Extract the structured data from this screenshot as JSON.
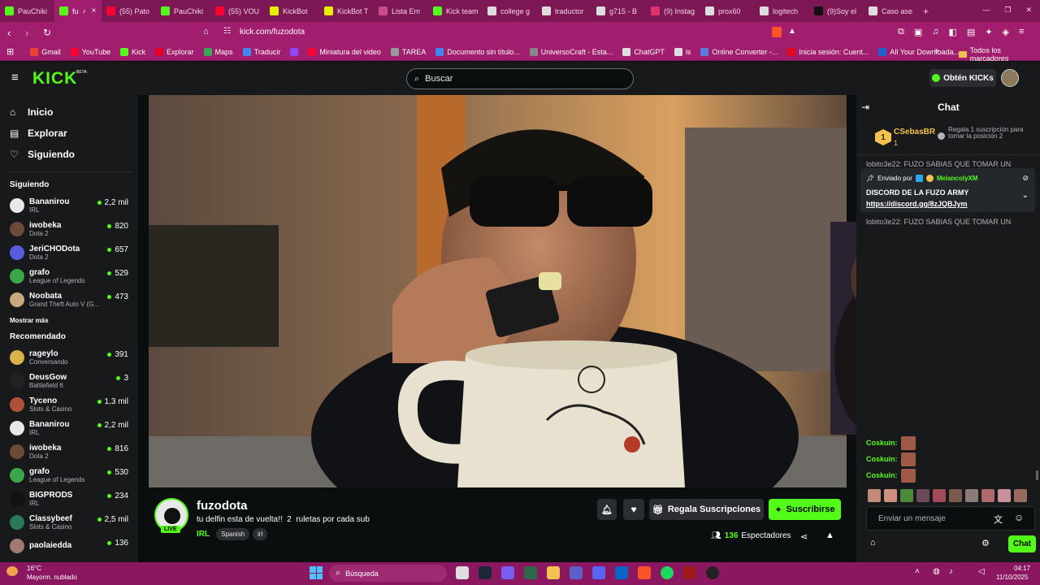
{
  "browser": {
    "tabs": [
      {
        "title": "PauChiki",
        "icon": "kick-icon",
        "color": "#53fc18"
      },
      {
        "title": "fu",
        "icon": "kick-icon",
        "color": "#53fc18",
        "active": true
      },
      {
        "title": "(55) Pato",
        "icon": "youtube-icon",
        "color": "#ff0033"
      },
      {
        "title": "PauChiki",
        "icon": "kick-icon",
        "color": "#53fc18"
      },
      {
        "title": "(55) VOU",
        "icon": "youtube-icon",
        "color": "#ff0033"
      },
      {
        "title": "KickBot",
        "icon": "kickbot-icon",
        "color": "#e4f000"
      },
      {
        "title": "KickBot T",
        "icon": "kickbot-icon",
        "color": "#e4f000"
      },
      {
        "title": "Lista Em",
        "icon": "list-icon",
        "color": "#c84b8b"
      },
      {
        "title": "Kick team",
        "icon": "kick-icon",
        "color": "#53fc18"
      },
      {
        "title": "college g",
        "icon": "globe-icon",
        "color": "#dddddd"
      },
      {
        "title": "traductor",
        "icon": "globe-icon",
        "color": "#dddddd"
      },
      {
        "title": "g715 - B",
        "icon": "globe-icon",
        "color": "#dddddd"
      },
      {
        "title": "(9) Instag",
        "icon": "instagram-icon",
        "color": "#e1306c"
      },
      {
        "title": "prox60",
        "icon": "globe-icon",
        "color": "#dddddd"
      },
      {
        "title": "logitech",
        "icon": "globe-icon",
        "color": "#dddddd"
      },
      {
        "title": "(9)Soy el",
        "icon": "tiktok-icon",
        "color": "#111111"
      },
      {
        "title": "Caso ase",
        "icon": "globe-icon",
        "color": "#dddddd"
      }
    ],
    "url": "kick.com/fuzodota",
    "bookmarks": [
      {
        "label": "Gmail",
        "color": "#ea4335"
      },
      {
        "label": "YouTube",
        "color": "#ff0033"
      },
      {
        "label": "Kick",
        "color": "#53fc18"
      },
      {
        "label": "Explorar",
        "color": "#e60023"
      },
      {
        "label": "Maps",
        "color": "#34a853"
      },
      {
        "label": "Traducir",
        "color": "#4285f4"
      },
      {
        "label": "",
        "color": "#9146ff"
      },
      {
        "label": "Miniatura del video",
        "color": "#ff0033"
      },
      {
        "label": "TAREA",
        "color": "#999999"
      },
      {
        "label": "Documento sin título...",
        "color": "#4285f4"
      },
      {
        "label": "UniversoCraft - Esta...",
        "color": "#888888"
      },
      {
        "label": "ChatGPT",
        "color": "#dddddd"
      },
      {
        "label": "is",
        "color": "#dddddd"
      },
      {
        "label": "Online Converter -...",
        "color": "#5a7be0"
      },
      {
        "label": "Inicia sesión: Cuent...",
        "color": "#e50914"
      },
      {
        "label": "All Your Downloada...",
        "color": "#1e63d6"
      }
    ],
    "bookmarks_all": "Todos los marcadores"
  },
  "kick": {
    "logo": "KICK",
    "beta": "BETA",
    "search_placeholder": "Buscar",
    "get_kicks": "Obtén KICKs",
    "nav": [
      {
        "label": "Inicio",
        "icon": "home-icon"
      },
      {
        "label": "Explorar",
        "icon": "explore-icon"
      },
      {
        "label": "Siguiendo",
        "icon": "heart-icon"
      }
    ],
    "following_title": "Siguiendo",
    "following": [
      {
        "name": "Bananirou",
        "category": "IRL",
        "viewers": "2,2 mil",
        "color": "#e8e8e8"
      },
      {
        "name": "iwobeka",
        "category": "Dota 2",
        "viewers": "820",
        "color": "#6b4a3a"
      },
      {
        "name": "JeriCHODota",
        "category": "Dota 2",
        "viewers": "657",
        "color": "#5a5ce0"
      },
      {
        "name": "grafo",
        "category": "League of Legends",
        "viewers": "529",
        "color": "#3aa84a"
      },
      {
        "name": "Noobata",
        "category": "Grand Theft Auto V (G...",
        "viewers": "473",
        "color": "#c9a880"
      }
    ],
    "show_more": "Mostrar más",
    "recommended_title": "Recomendado",
    "recommended": [
      {
        "name": "rageylo",
        "category": "Conversando",
        "viewers": "391",
        "color": "#d9b24a"
      },
      {
        "name": "DeusGow",
        "category": "Battlefield 6",
        "viewers": "3",
        "color": "#222222"
      },
      {
        "name": "Tyceno",
        "category": "Slots & Casino",
        "viewers": "1,3 mil",
        "color": "#b0503a"
      },
      {
        "name": "Bananirou",
        "category": "IRL",
        "viewers": "2,2 mil",
        "color": "#e8e8e8"
      },
      {
        "name": "iwobeka",
        "category": "Dota 2",
        "viewers": "816",
        "color": "#6b4a3a"
      },
      {
        "name": "grafo",
        "category": "League of Legends",
        "viewers": "530",
        "color": "#3aa84a"
      },
      {
        "name": "BIGPRODS",
        "category": "IRL",
        "viewers": "234",
        "color": "#111111"
      },
      {
        "name": "Classybeef",
        "category": "Slots & Casino",
        "viewers": "2,5 mil",
        "color": "#2a7a5a"
      },
      {
        "name": "paolaiedda",
        "category": "",
        "viewers": "136",
        "color": "#a07a70"
      }
    ],
    "stream": {
      "channel": "fuzodota",
      "title": "tu delfin esta de vuelta!!  2  ruletas por cada sub",
      "category": "IRL",
      "tags": [
        "Spanish",
        "irl"
      ],
      "live_badge": "LIVE",
      "gift_subs": "Regala Suscripciones",
      "subscribe": "Suscribirse",
      "viewers": "136",
      "viewers_label": "Espectadores"
    },
    "chat": {
      "title": "Chat",
      "top_gifter": {
        "name": "CSebasBR",
        "count": "1",
        "rank": "1",
        "cta": "Regala 1 suscripción para tomar la posición 2"
      },
      "partial_msg_1": "lobito3e22: FUZO SABIAS QUE TOMAR UN",
      "pinned": {
        "label": "Enviado por",
        "author": "MelancolyXM",
        "title": "DISCORD DE LA FUZO ARMY",
        "link": "https://discord.gg/8zJQBJym"
      },
      "partial_msg_2": "lobito3e22: FUZO SABIAS QUE TOMAR UN",
      "messages": [
        {
          "user": "Coskuin:"
        },
        {
          "user": "Coskuin:"
        },
        {
          "user": "Coskuin:"
        }
      ],
      "input_placeholder": "Enviar un mensaje",
      "send": "Chat"
    }
  },
  "taskbar": {
    "weather_temp": "16°C",
    "weather_desc": "Mayorm. nublado",
    "search": "Búsqueda",
    "time": "04:17",
    "date": "11/10/2025"
  },
  "colors": {
    "kick_green": "#53fc18",
    "chrome_pink": "#a11d6d",
    "panel": "#18191b"
  }
}
